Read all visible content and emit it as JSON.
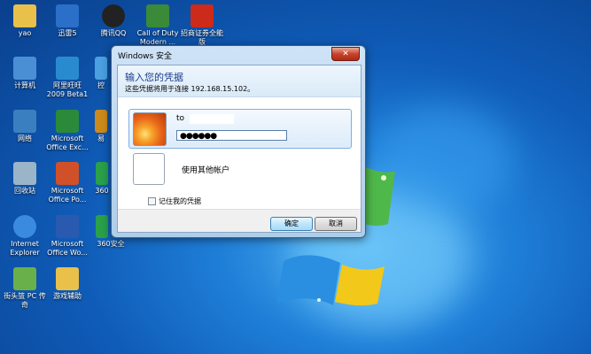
{
  "desktop": {
    "icons": [
      {
        "label": "yao",
        "color": "#e8c04a"
      },
      {
        "label": "迅雷5",
        "color": "#2b6fc8"
      },
      {
        "label": "腾讯QQ",
        "color": "#222222"
      },
      {
        "label": "Call of Duty\nModern ...",
        "color": "#3a8a3a"
      },
      {
        "label": "招商证券全能\n版",
        "color": "#cc2a1a"
      },
      {
        "label": "计算机",
        "color": "#4a8fd4"
      },
      {
        "label": "阿里旺旺\n2009 Beta1",
        "color": "#2a8ad0"
      },
      {
        "label": "控",
        "color": "#4aa0e0"
      },
      {
        "label": "网络",
        "color": "#3a80c0"
      },
      {
        "label": "Microsoft\nOffice Exc...",
        "color": "#2a8a3a"
      },
      {
        "label": "易",
        "color": "#cc8a1a"
      },
      {
        "label": "回收站",
        "color": "#9ab4c8"
      },
      {
        "label": "Microsoft\nOffice Po...",
        "color": "#d0502a"
      },
      {
        "label": "360",
        "color": "#2aa04a"
      },
      {
        "label": "Internet\nExplorer",
        "color": "#3a8ae0"
      },
      {
        "label": "Microsoft\nOffice Wo...",
        "color": "#2a5ab0"
      },
      {
        "label": "360安全",
        "color": "#2aa04a"
      },
      {
        "label": "街头篮 PC 传\n奇",
        "color": "#6ab04a"
      },
      {
        "label": "游戏辅助",
        "color": "#e8c04a"
      }
    ]
  },
  "dialog": {
    "title": "Windows 安全",
    "close_label": "✕",
    "heading": "输入您的凭据",
    "subtext": "这些凭据将用于连接 192.168.15.102。",
    "credential": {
      "username": "to",
      "password_mask": "●●●●●●"
    },
    "other_account_label": "使用其他帐户",
    "remember_label": "记住我的凭据",
    "ok_label": "确定",
    "cancel_label": "取消"
  }
}
